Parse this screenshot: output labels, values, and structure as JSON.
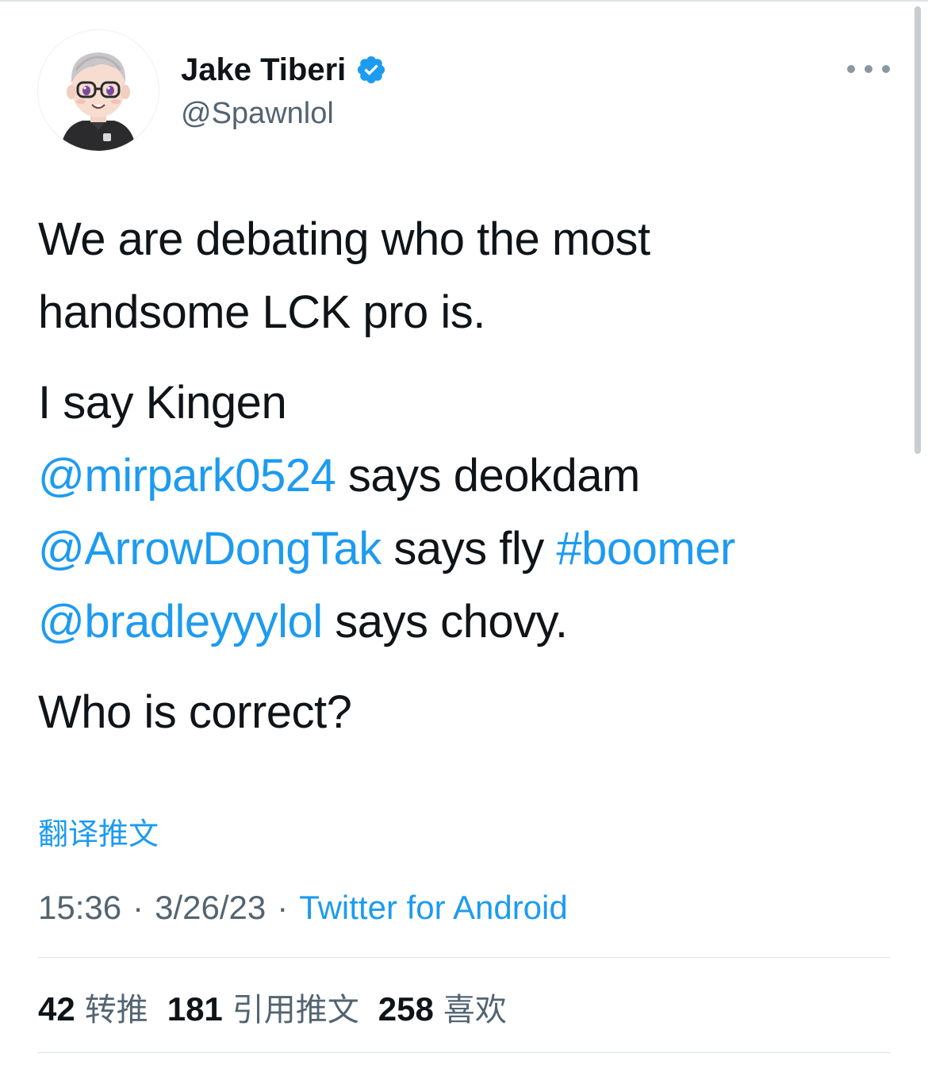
{
  "author": {
    "display_name": "Jake Tiberi",
    "handle": "@Spawnlol",
    "verified": true,
    "avatar": "cartoon-avatar"
  },
  "tweet": {
    "line1": "We are debating who the most",
    "line2": "handsome LCK pro is.",
    "line3": "I say Kingen",
    "mention1": "@mirpark0524",
    "line4_rest": " says deokdam",
    "mention2": "@ArrowDongTak",
    "line5_mid": " says fly ",
    "hashtag": "#boomer",
    "mention3": "@bradleyyylol",
    "line6_rest": " says chovy.",
    "line7": "Who is correct?"
  },
  "translate_label": "翻译推文",
  "meta": {
    "time": "15:36",
    "date": "3/26/23",
    "separator": "·",
    "source": "Twitter for Android"
  },
  "stats": {
    "retweets_count": "42",
    "retweets_label": "转推",
    "quotes_count": "181",
    "quotes_label": "引用推文",
    "likes_count": "258",
    "likes_label": "喜欢"
  },
  "colors": {
    "link": "#1d9bf0",
    "text": "#0f1419",
    "secondary": "#536471",
    "verified": "#1d9bf0"
  }
}
